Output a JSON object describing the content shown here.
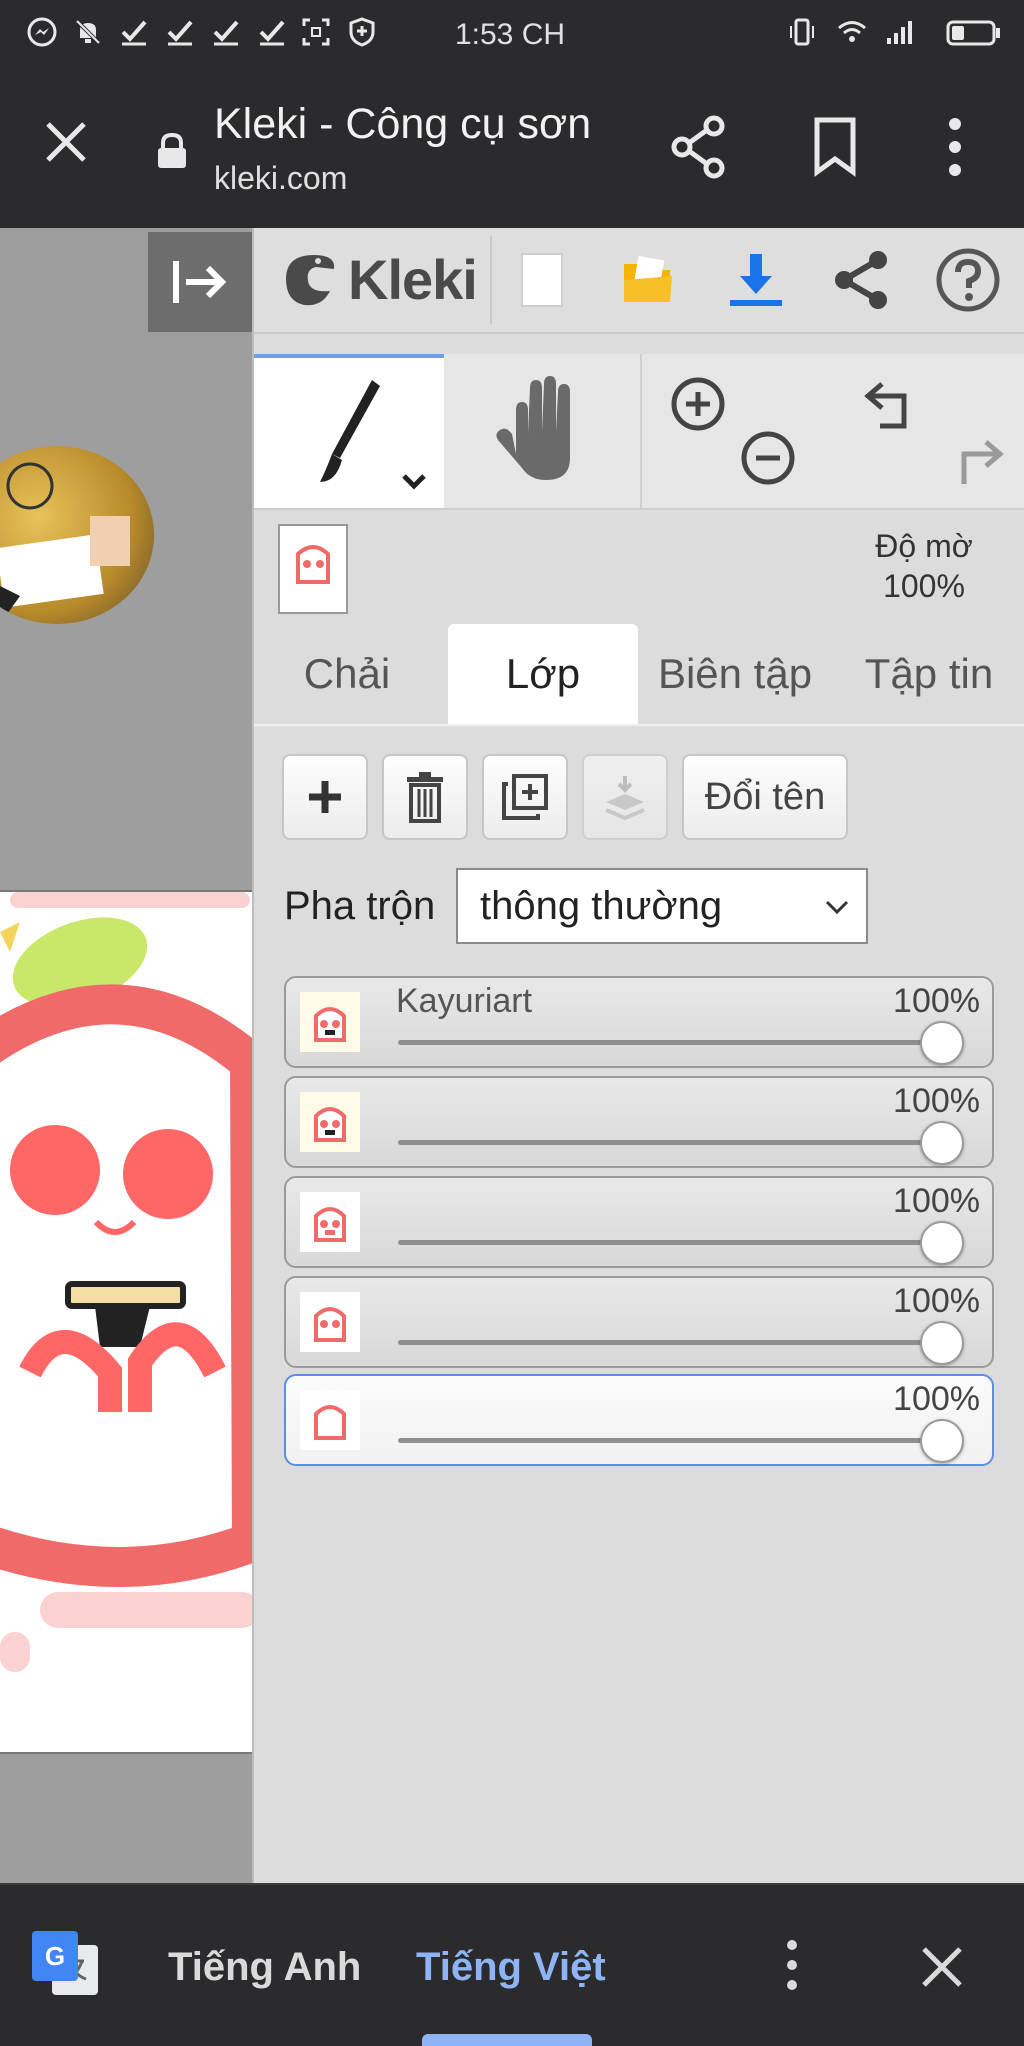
{
  "status_bar": {
    "time": "1:53 CH",
    "left_icons": [
      "messenger-icon",
      "bell-off-icon",
      "check-icon",
      "check-icon",
      "check-icon",
      "check-icon",
      "screenshot-icon",
      "shield-icon"
    ],
    "right_icons": [
      "vibrate-icon",
      "wifi-icon",
      "signal-icon",
      "battery-icon"
    ]
  },
  "browser": {
    "title": "Kleki - Công cụ sơn",
    "url": "kleki.com"
  },
  "app": {
    "logo_text": "Kleki",
    "opacity_label": "Độ mờ",
    "opacity_value": "100%",
    "tabs": [
      {
        "label": "Chải",
        "active": false
      },
      {
        "label": "Lớp",
        "active": true
      },
      {
        "label": "Biên tập",
        "active": false
      },
      {
        "label": "Tập tin",
        "active": false
      }
    ],
    "rename_label": "Đổi tên",
    "blend_label": "Pha trộn",
    "blend_value": "thông thường",
    "layers": [
      {
        "name": "Kayuriart",
        "opacity": "100%",
        "selected": false
      },
      {
        "name": "",
        "opacity": "100%",
        "selected": false
      },
      {
        "name": "",
        "opacity": "100%",
        "selected": false
      },
      {
        "name": "",
        "opacity": "100%",
        "selected": false
      },
      {
        "name": "",
        "opacity": "100%",
        "selected": true
      }
    ]
  },
  "translate_bar": {
    "source_lang": "Tiếng Anh",
    "target_lang": "Tiếng Việt"
  },
  "colors": {
    "accent_blue": "#1a73e8",
    "selected_border": "#5b8ee6",
    "folder_yellow": "#f4b400"
  }
}
